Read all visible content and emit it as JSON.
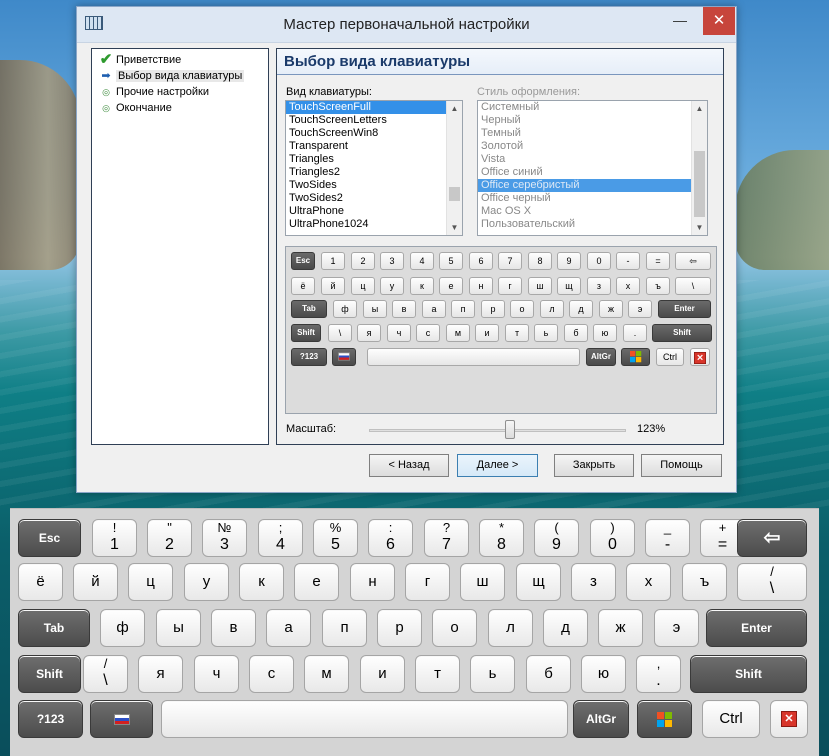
{
  "window": {
    "title": "Мастер первоначальной настройки",
    "min_icon": "—",
    "max_icon": "☐",
    "close_icon": "✕"
  },
  "nav": [
    {
      "label": "Приветствие",
      "icon": "✔",
      "state": "done"
    },
    {
      "label": "Выбор вида клавиатуры",
      "icon": "➡",
      "state": "current"
    },
    {
      "label": "Прочие настройки",
      "icon": "◎",
      "state": "pending"
    },
    {
      "label": "Окончание",
      "icon": "◎",
      "state": "pending"
    }
  ],
  "panel": {
    "heading": "Выбор вида клавиатуры",
    "kb_label": "Вид клавиатуры:",
    "style_label": "Стиль оформления:",
    "kb_list": [
      "TouchScreenFull",
      "TouchScreenLetters",
      "TouchScreenWin8",
      "Transparent",
      "Triangles",
      "Triangles2",
      "TwoSides",
      "TwoSides2",
      "UltraPhone",
      "UltraPhone1024"
    ],
    "kb_selected": 0,
    "style_list": [
      "Системный",
      "Черный",
      "Темный",
      "Золотой",
      "Vista",
      "Office синий",
      "Office серебристый",
      "Office черный",
      "Mac OS X",
      "Пользовательский"
    ],
    "style_selected": 6,
    "scale_label": "Масштаб:",
    "scale_value": "123%",
    "scale_fraction": 0.55
  },
  "preview_rows": [
    [
      {
        "l": "Esc",
        "d": true
      },
      {
        "l": "1"
      },
      {
        "l": "2"
      },
      {
        "l": "3"
      },
      {
        "l": "4"
      },
      {
        "l": "5"
      },
      {
        "l": "6"
      },
      {
        "l": "7"
      },
      {
        "l": "8"
      },
      {
        "l": "9"
      },
      {
        "l": "0"
      },
      {
        "l": "-"
      },
      {
        "l": "="
      },
      {
        "l": "⇦"
      }
    ],
    [
      {
        "l": "ё"
      },
      {
        "l": "й"
      },
      {
        "l": "ц"
      },
      {
        "l": "у"
      },
      {
        "l": "к"
      },
      {
        "l": "е"
      },
      {
        "l": "н"
      },
      {
        "l": "г"
      },
      {
        "l": "ш"
      },
      {
        "l": "щ"
      },
      {
        "l": "з"
      },
      {
        "l": "х"
      },
      {
        "l": "ъ"
      },
      {
        "l": "\\"
      }
    ],
    [
      {
        "l": "Tab",
        "d": true
      },
      {
        "l": "ф"
      },
      {
        "l": "ы"
      },
      {
        "l": "в"
      },
      {
        "l": "а"
      },
      {
        "l": "п"
      },
      {
        "l": "р"
      },
      {
        "l": "о"
      },
      {
        "l": "л"
      },
      {
        "l": "д"
      },
      {
        "l": "ж"
      },
      {
        "l": "э"
      },
      {
        "l": "Enter",
        "d": true
      }
    ],
    [
      {
        "l": "Shift",
        "d": true
      },
      {
        "l": "\\"
      },
      {
        "l": "я"
      },
      {
        "l": "ч"
      },
      {
        "l": "с"
      },
      {
        "l": "м"
      },
      {
        "l": "и"
      },
      {
        "l": "т"
      },
      {
        "l": "ь"
      },
      {
        "l": "б"
      },
      {
        "l": "ю"
      },
      {
        "l": "."
      },
      {
        "l": "Shift",
        "d": true
      }
    ],
    [
      {
        "l": "?123",
        "d": true
      },
      {
        "l": "flag",
        "d": true
      },
      {
        "l": ""
      },
      {
        "l": "AltGr",
        "d": true
      },
      {
        "l": "win",
        "d": true
      },
      {
        "l": "Ctrl"
      },
      {
        "l": "x"
      }
    ]
  ],
  "buttons": {
    "back": "< Назад",
    "next": "Далее >",
    "close": "Закрыть",
    "help": "Помощь"
  },
  "keyboard_rows": [
    [
      {
        "c": "Esc",
        "d": true
      },
      {
        "t": "!",
        "b": "1"
      },
      {
        "t": "\"",
        "b": "2"
      },
      {
        "t": "№",
        "b": "3"
      },
      {
        "t": ";",
        "b": "4"
      },
      {
        "t": "%",
        "b": "5"
      },
      {
        "t": ":",
        "b": "6"
      },
      {
        "t": "?",
        "b": "7"
      },
      {
        "t": "*",
        "b": "8"
      },
      {
        "t": "(",
        "b": "9"
      },
      {
        "t": ")",
        "b": "0"
      },
      {
        "t": "_",
        "b": "-"
      },
      {
        "t": "+",
        "b": "="
      },
      {
        "c": "⇦",
        "d": true
      }
    ],
    [
      {
        "c": "ё"
      },
      {
        "c": "й"
      },
      {
        "c": "ц"
      },
      {
        "c": "у"
      },
      {
        "c": "к"
      },
      {
        "c": "е"
      },
      {
        "c": "н"
      },
      {
        "c": "г"
      },
      {
        "c": "ш"
      },
      {
        "c": "щ"
      },
      {
        "c": "з"
      },
      {
        "c": "х"
      },
      {
        "c": "ъ"
      },
      {
        "t": "/",
        "b": "\\"
      }
    ],
    [
      {
        "c": "Tab",
        "d": true
      },
      {
        "c": "ф"
      },
      {
        "c": "ы"
      },
      {
        "c": "в"
      },
      {
        "c": "а"
      },
      {
        "c": "п"
      },
      {
        "c": "р"
      },
      {
        "c": "о"
      },
      {
        "c": "л"
      },
      {
        "c": "д"
      },
      {
        "c": "ж"
      },
      {
        "c": "э"
      },
      {
        "c": "Enter",
        "d": true
      }
    ],
    [
      {
        "c": "Shift",
        "d": true
      },
      {
        "t": "/",
        "b": "\\"
      },
      {
        "c": "я"
      },
      {
        "c": "ч"
      },
      {
        "c": "с"
      },
      {
        "c": "м"
      },
      {
        "c": "и"
      },
      {
        "c": "т"
      },
      {
        "c": "ь"
      },
      {
        "c": "б"
      },
      {
        "c": "ю"
      },
      {
        "t": ",",
        "b": "."
      },
      {
        "c": "Shift",
        "d": true
      }
    ],
    [
      {
        "c": "?123",
        "d": true
      },
      {
        "c": "flag",
        "d": true
      },
      {
        "c": ""
      },
      {
        "c": "AltGr",
        "d": true
      },
      {
        "c": "win",
        "d": true
      },
      {
        "c": "Ctrl"
      },
      {
        "c": "x"
      }
    ]
  ]
}
